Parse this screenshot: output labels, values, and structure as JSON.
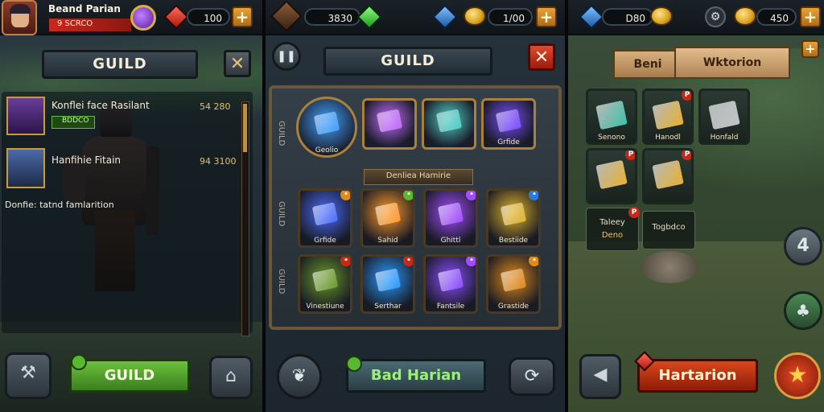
{
  "panel1": {
    "player_name": "Beand Parian",
    "player_sub": "9 SCRCO",
    "gem_count": "100",
    "title": "GUILD",
    "close_glyph": "✕",
    "members": [
      {
        "name": "Konflei face Rasilant",
        "tag": "BDDCO",
        "score": "54 280"
      },
      {
        "name": "Hanfihie Fitain",
        "score": "94 3100"
      }
    ],
    "footer_text": "Donfie: tatnd famlarition",
    "action_label": "GUILD",
    "icons": {
      "avatar": "hero-portrait-icon",
      "class": "purple-emblem-icon",
      "gem": "red-gem-icon",
      "plus": "plus-icon",
      "anvil": "anvil-icon",
      "castle": "castle-icon"
    }
  },
  "panel2": {
    "gold_count": "3830",
    "currency_count": "1/00",
    "title": "GUILD",
    "close_glyph": "✕",
    "section_banner": "Denliea Hamirie",
    "row_labels": [
      "GUILD",
      "GUILD",
      "GUILD"
    ],
    "featured": [
      {
        "label": "Geolio",
        "color": "#3fa0ff"
      },
      {
        "label": "",
        "color": "#c36bff"
      },
      {
        "label": "",
        "color": "#4fd0c8"
      },
      {
        "label": "Grfide",
        "color": "#7a4cff"
      }
    ],
    "items": [
      {
        "label": "Grfide",
        "color": "#4a6cff"
      },
      {
        "label": "Sahid",
        "color": "#ff9a2a"
      },
      {
        "label": "Ghittl",
        "color": "#a24cff"
      },
      {
        "label": "Bestiide",
        "color": "#e0b42a"
      },
      {
        "label": "Vinestiune",
        "color": "#6a9a2a"
      },
      {
        "label": "Serthar",
        "color": "#2a9aff"
      },
      {
        "label": "Fantsile",
        "color": "#8a4cff"
      },
      {
        "label": "Grastide",
        "color": "#e08a1a"
      }
    ],
    "action_label": "Bad Harian",
    "icons": {
      "pause": "pause-icon",
      "leaf": "leaf-icon",
      "swirl": "swirl-icon",
      "gold": "gold-chest-icon",
      "green_gem": "green-gem-icon",
      "blue_gem": "blue-gem-icon",
      "coin": "coin-icon"
    }
  },
  "panel3": {
    "gem_count": "D80",
    "coin_count": "450",
    "banner_left": "Beni",
    "banner_right": "Wktorion",
    "items": [
      {
        "label": "Senono",
        "color": "#3fc0a8"
      },
      {
        "label": "Hanodl",
        "color": "#e8b030"
      },
      {
        "label": "Honfald",
        "color": "#c0c4c8"
      },
      {
        "label": "",
        "color": "#e8b030"
      },
      {
        "label": "",
        "color": "#e8b030"
      }
    ],
    "info_cards": [
      {
        "line1": "Taleey",
        "line2": "Deno"
      },
      {
        "line1": "Togbdco",
        "line2": ""
      }
    ],
    "action_label": "Hartarion",
    "side_count": "4",
    "icons": {
      "blue_gem": "blue-gem-icon",
      "coin": "coin-icon",
      "settings": "gear-icon",
      "back": "back-triangle-icon",
      "star": "star-icon",
      "tree": "tree-icon",
      "red_gem": "red-gem-icon"
    }
  }
}
